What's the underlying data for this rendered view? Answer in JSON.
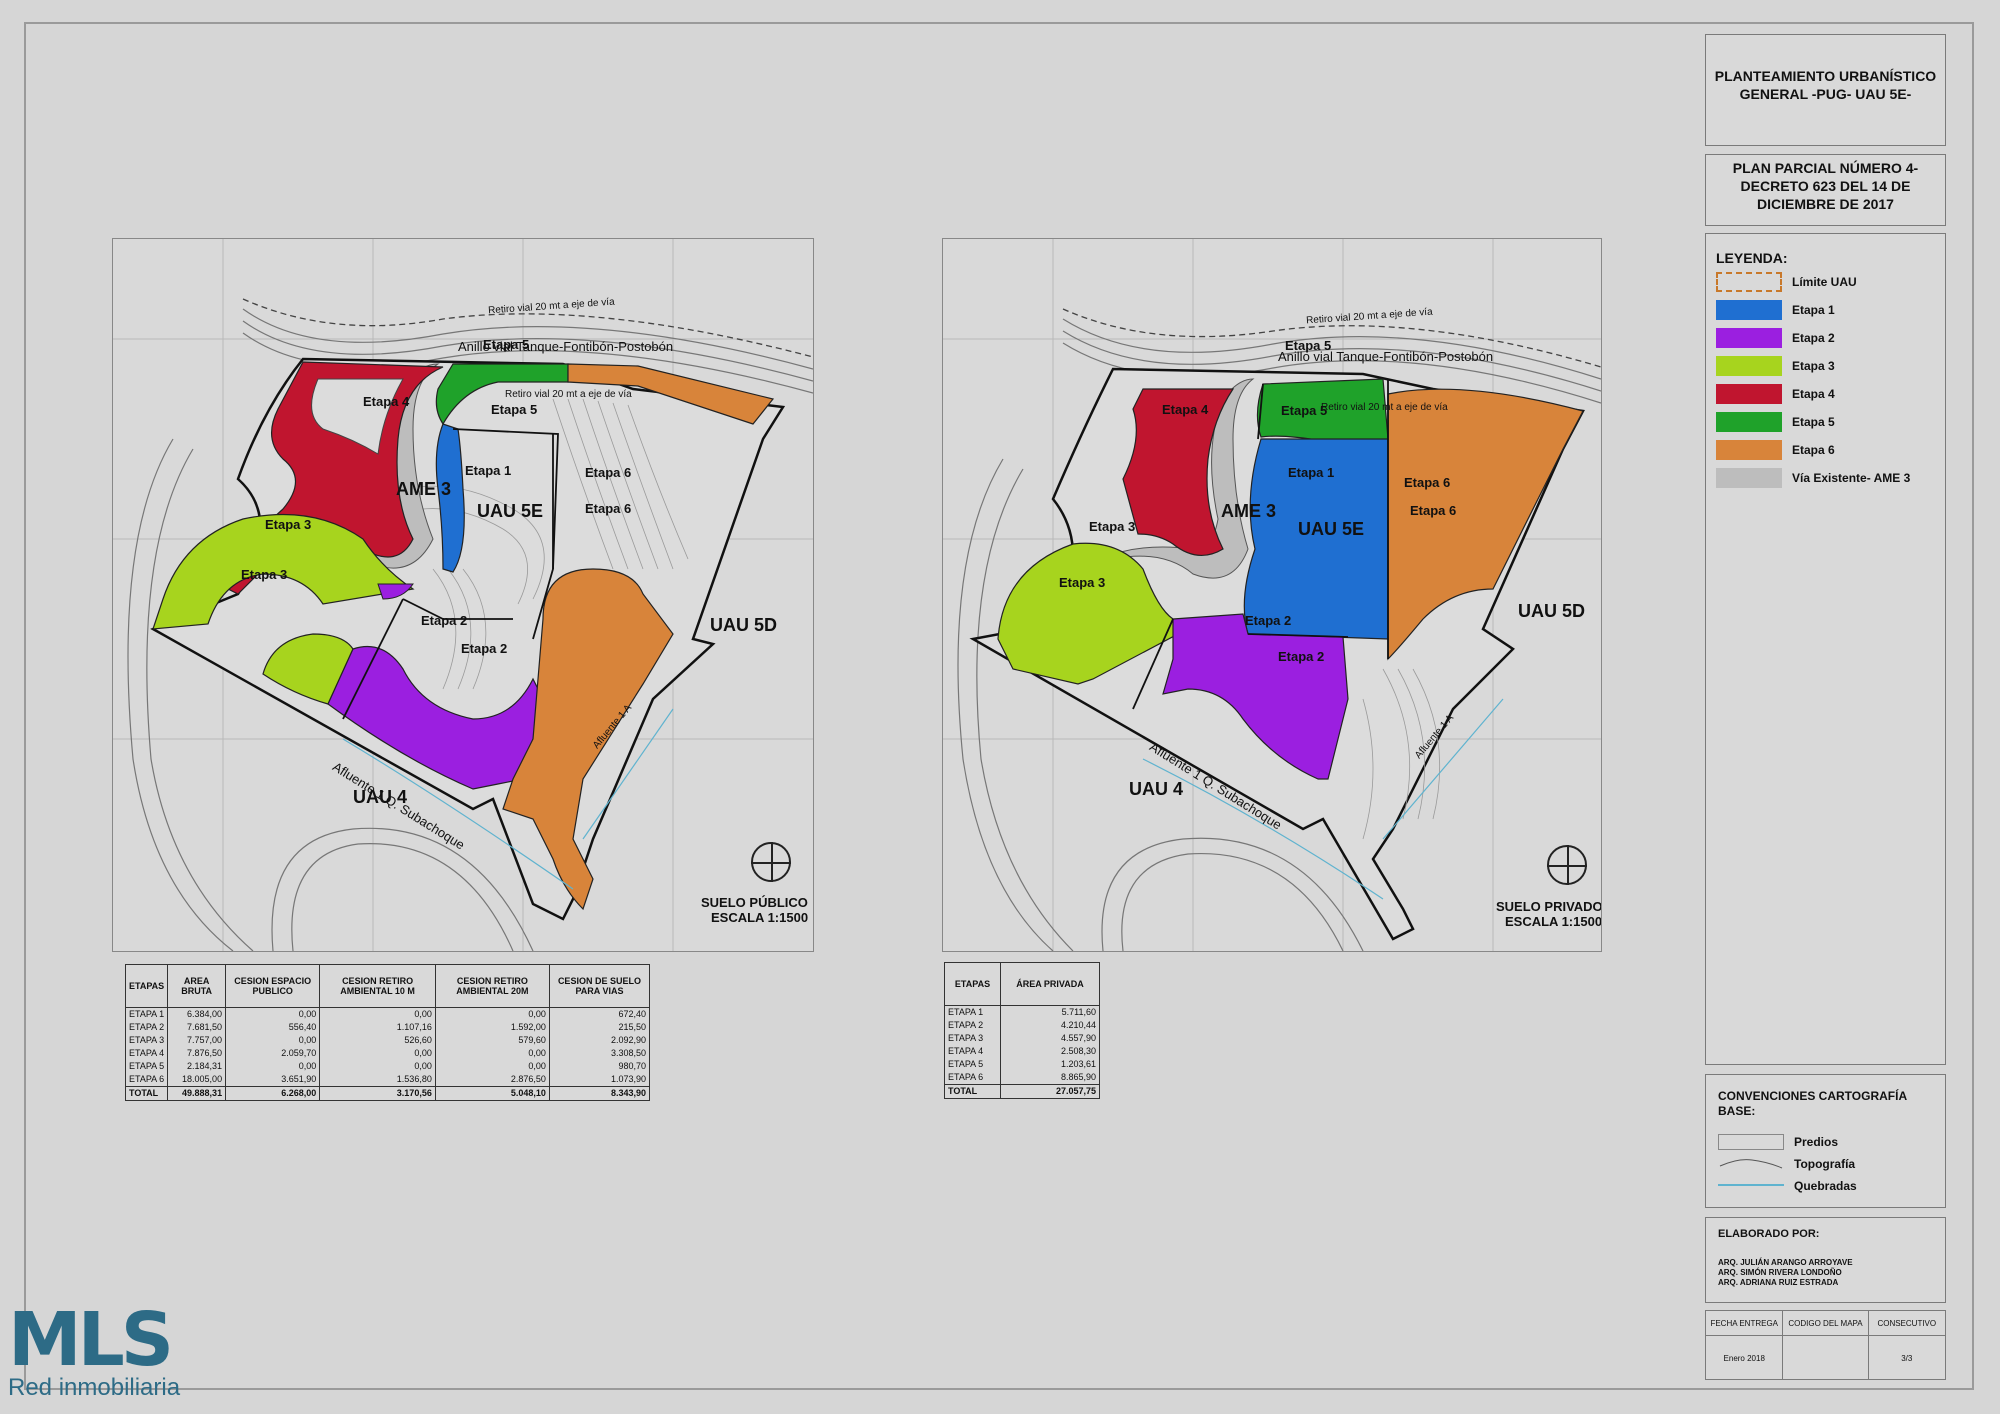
{
  "header": {
    "title1": "PLANTEAMIENTO URBANÍSTICO GENERAL -PUG- UAU 5E-",
    "title2": "PLAN PARCIAL NÚMERO 4- DECRETO 623 DEL 14 DE DICIEMBRE DE 2017"
  },
  "legend": {
    "title": "LEYENDA:",
    "items": [
      {
        "label": "Límite UAU",
        "color": "#d9d9d9",
        "border": "#c8782a"
      },
      {
        "label": "Etapa 1",
        "color": "#1f6fd1"
      },
      {
        "label": "Etapa 2",
        "color": "#9b1fe0"
      },
      {
        "label": "Etapa 3",
        "color": "#a7d41e"
      },
      {
        "label": "Etapa 4",
        "color": "#c0152f"
      },
      {
        "label": "Etapa 5",
        "color": "#1fa22a"
      },
      {
        "label": "Etapa 6",
        "color": "#d8843a"
      },
      {
        "label": "Vía Existente- AME 3",
        "color": "#bdbdbd"
      }
    ]
  },
  "conventions": {
    "title": "CONVENCIONES CARTOGRAFÍA BASE:",
    "items": [
      "Predios",
      "Topografía",
      "Quebradas"
    ]
  },
  "credits": {
    "title": "ELABORADO POR:",
    "names": [
      "ARQ. JULIÁN ARANGO ARROYAVE",
      "ARQ. SIMÓN RIVERA LONDOÑO",
      "ARQ. ADRIANA RUIZ ESTRADA"
    ]
  },
  "footer": {
    "headers": [
      "FECHA ENTREGA",
      "CODIGO DEL MAPA",
      "CONSECUTIVO"
    ],
    "values": [
      "Enero 2018",
      "",
      "3/3"
    ]
  },
  "map_public": {
    "labels": {
      "road_top": "Retiro vial 20 mt a eje de vía",
      "road_name": "Anillo vial Tanque-Fontibón-Postobón",
      "road_inner": "Retiro vial 20 mt a eje de vía",
      "etapa1": "Etapa 1",
      "etapa2a": "Etapa 2",
      "etapa2b": "Etapa 2",
      "etapa3a": "Etapa 3",
      "etapa3b": "Etapa 3",
      "etapa4": "Etapa 4",
      "etapa5a": "Etapa 5",
      "etapa5b": "Etapa 5",
      "etapa6a": "Etapa 6",
      "etapa6b": "Etapa 6",
      "ame": "AME 3",
      "uau5e": "UAU 5E",
      "uau5d": "UAU 5D",
      "uau4": "UAU 4",
      "stream": "Afluente 1 Q. Subachoque",
      "stream2": "Afluente 1 A",
      "caption1": "SUELO PÚBLICO",
      "caption2": "ESCALA 1:1500"
    }
  },
  "map_private": {
    "labels": {
      "road_top": "Retiro vial 20 mt a eje de vía",
      "road_name": "Anillo vial Tanque-Fontibón-Postobón",
      "road_inner": "Retiro vial 20 mt a eje de vía",
      "etapa1": "Etapa 1",
      "etapa2a": "Etapa 2",
      "etapa2b": "Etapa 2",
      "etapa3a": "Etapa 3",
      "etapa3b": "Etapa 3",
      "etapa4": "Etapa 4",
      "etapa5a": "Etapa 5",
      "etapa5b": "Etapa 5",
      "etapa6a": "Etapa 6",
      "etapa6b": "Etapa 6",
      "ame": "AME 3",
      "uau5e": "UAU 5E",
      "uau5d": "UAU 5D",
      "uau4": "UAU 4",
      "stream": "Afluente 1 Q. Subachoque",
      "stream2": "Afluente 1 A",
      "caption1": "SUELO PRIVADO",
      "caption2": "ESCALA 1:1500"
    }
  },
  "table_public": {
    "headers": [
      "ETAPAS",
      "AREA BRUTA",
      "CESION ESPACIO PUBLICO",
      "CESION RETIRO AMBIENTAL 10 M",
      "CESION RETIRO AMBIENTAL 20M",
      "CESION DE SUELO PARA VIAS"
    ],
    "rows": [
      [
        "ETAPA 1",
        "6.384,00",
        "0,00",
        "0,00",
        "0,00",
        "672,40"
      ],
      [
        "ETAPA 2",
        "7.681,50",
        "556,40",
        "1.107,16",
        "1.592,00",
        "215,50"
      ],
      [
        "ETAPA 3",
        "7.757,00",
        "0,00",
        "526,60",
        "579,60",
        "2.092,90"
      ],
      [
        "ETAPA 4",
        "7.876,50",
        "2.059,70",
        "0,00",
        "0,00",
        "3.308,50"
      ],
      [
        "ETAPA 5",
        "2.184,31",
        "0,00",
        "0,00",
        "0,00",
        "980,70"
      ],
      [
        "ETAPA 6",
        "18.005,00",
        "3.651,90",
        "1.536,80",
        "2.876,50",
        "1.073,90"
      ]
    ],
    "total": [
      "TOTAL",
      "49.888,31",
      "6.268,00",
      "3.170,56",
      "5.048,10",
      "8.343,90"
    ]
  },
  "table_private": {
    "headers": [
      "ETAPAS",
      "ÁREA PRIVADA"
    ],
    "rows": [
      [
        "ETAPA 1",
        "5.711,60"
      ],
      [
        "ETAPA 2",
        "4.210,44"
      ],
      [
        "ETAPA 3",
        "4.557,90"
      ],
      [
        "ETAPA 4",
        "2.508,30"
      ],
      [
        "ETAPA 5",
        "1.203,61"
      ],
      [
        "ETAPA 6",
        "8.865,90"
      ]
    ],
    "total": [
      "TOTAL",
      "27.057,75"
    ]
  },
  "logo": {
    "mark": "MLS",
    "sub": "Red inmobiliaria",
    "color": "#2d6b86"
  }
}
